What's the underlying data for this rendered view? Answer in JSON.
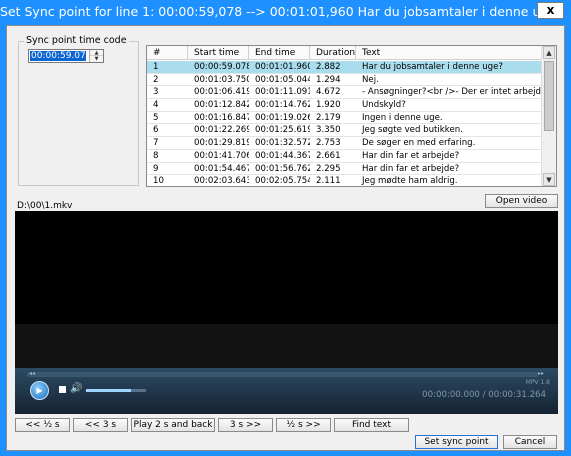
{
  "window": {
    "title": "Set Sync point for line 1: 00:00:59,078 --> 00:01:01,960 Har du jobsamtaler i denne uge?",
    "close_label": "x"
  },
  "sync_point": {
    "group_label": "Sync point time code",
    "value": "00:00:59.078",
    "up_glyph": "▲",
    "down_glyph": "▼"
  },
  "table": {
    "columns": [
      "#",
      "Start time",
      "End time",
      "Duration",
      "Text"
    ],
    "rows": [
      {
        "num": "1",
        "start": "00:00:59.078",
        "end": "00:01:01.960",
        "duration": "2.882",
        "text": "Har du jobsamtaler i denne uge?",
        "selected": true
      },
      {
        "num": "2",
        "start": "00:01:03.750",
        "end": "00:01:05.044",
        "duration": "1.294",
        "text": "Nej."
      },
      {
        "num": "3",
        "start": "00:01:06.419",
        "end": "00:01:11.091",
        "duration": "4.672",
        "text": "- Ansøgninger?<br />- Der er intet arbejde."
      },
      {
        "num": "4",
        "start": "00:01:12.842",
        "end": "00:01:14.762",
        "duration": "1.920",
        "text": "Undskyld?"
      },
      {
        "num": "5",
        "start": "00:01:16.847",
        "end": "00:01:19.026",
        "duration": "2.179",
        "text": "Ingen i denne uge."
      },
      {
        "num": "6",
        "start": "00:01:22.269",
        "end": "00:01:25.619",
        "duration": "3.350",
        "text": "Jeg søgte ved butikken."
      },
      {
        "num": "7",
        "start": "00:01:29.819",
        "end": "00:01:32.572",
        "duration": "2.753",
        "text": "De søger en med erfaring."
      },
      {
        "num": "8",
        "start": "00:01:41.706",
        "end": "00:01:44.367",
        "duration": "2.661",
        "text": "Har din far et arbejde?"
      },
      {
        "num": "9",
        "start": "00:01:54.467",
        "end": "00:01:56.762",
        "duration": "2.295",
        "text": "Har din far et arbejde?"
      },
      {
        "num": "10",
        "start": "00:02:03.643",
        "end": "00:02:05.754",
        "duration": "2.111",
        "text": "Jeg mødte ham aldrig."
      }
    ],
    "scroll_up_glyph": "▲",
    "scroll_down_glyph": "▼"
  },
  "video": {
    "file_path": "D:\\00\\1.mkv",
    "open_label": "Open video",
    "seek_left_glyph": "◂◂",
    "seek_right_glyph": "▸▸",
    "play_glyph": "▶",
    "volume_glyph": "🔊",
    "volume_level": 0.75,
    "player_tag": "MPV 1.8",
    "time_display": "00:00:00.000 / 00:00:31.264"
  },
  "buttons": {
    "back_half": "<< ½ s",
    "back_3": "<< 3 s",
    "play_2_back": "Play 2 s and back",
    "fwd_3": "3 s >>",
    "fwd_half": "½ s >>",
    "find_text": "Find text",
    "set_sync": "Set sync point",
    "cancel": "Cancel"
  },
  "colors": {
    "title_bar": "#1e90ff",
    "selection": "#0a64d2",
    "selected_row": "#a9dcec"
  }
}
